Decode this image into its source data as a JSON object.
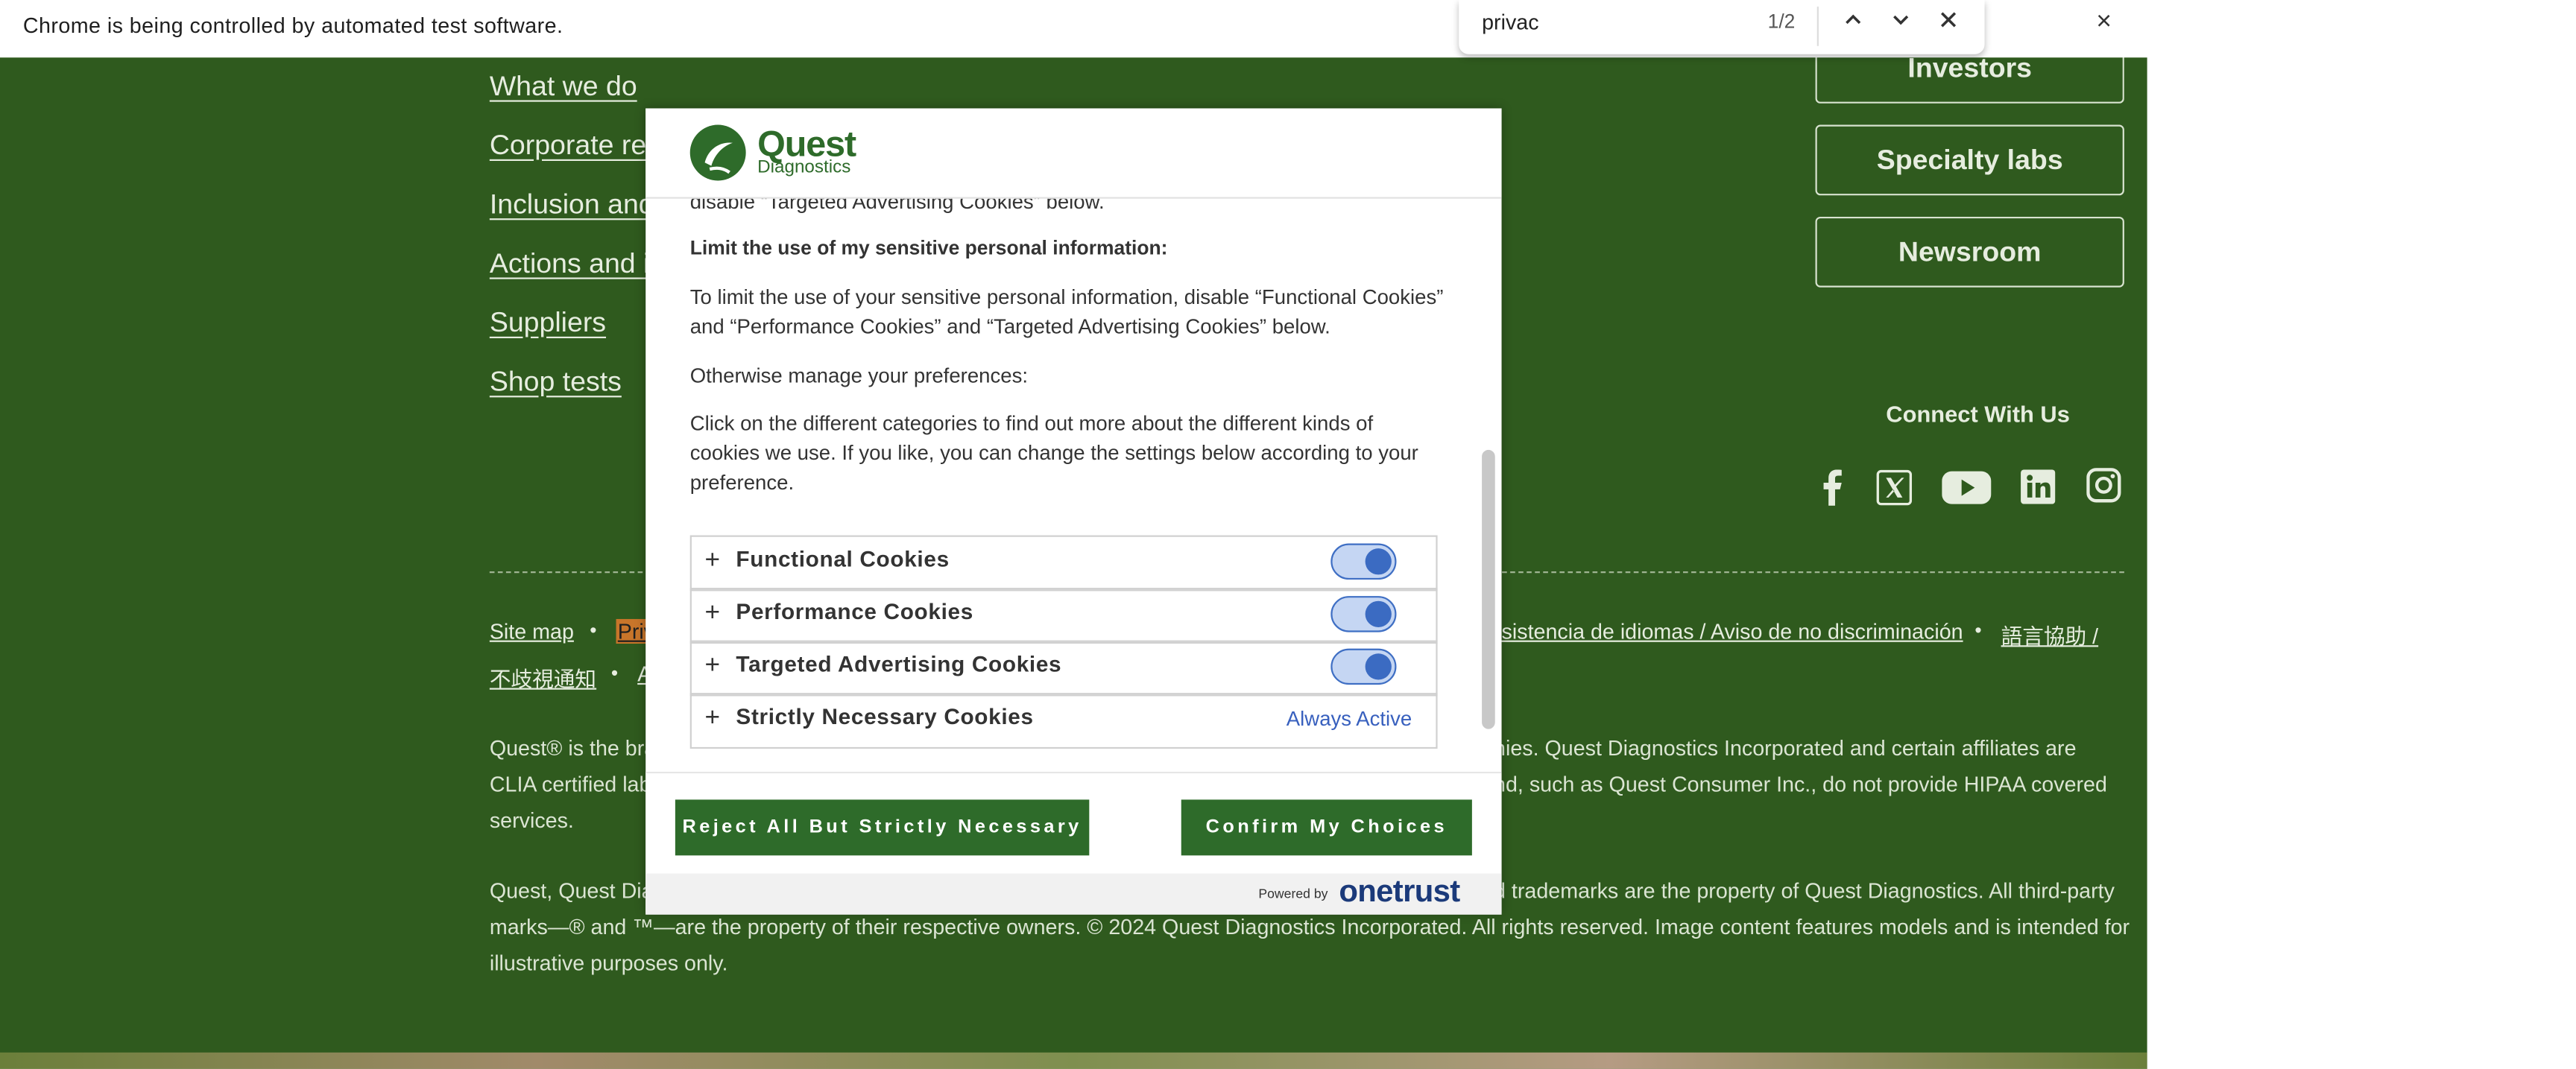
{
  "banner": {
    "text": "Chrome is being controlled by automated test software.",
    "close_icon": "×"
  },
  "find": {
    "query": "privac",
    "count": "1/2",
    "prev": "⌃",
    "next": "⌄",
    "close": "×"
  },
  "footer": {
    "links": [
      "What we do",
      "Corporate res",
      "Inclusion and",
      "Actions and in",
      "Suppliers",
      "Shop tests"
    ],
    "side_buttons": [
      "Investors",
      "Specialty labs",
      "Newsroom"
    ],
    "connect": "Connect With Us",
    "bottom_links": {
      "site_map": "Site map",
      "privacy": "Priv",
      "spanish": "sistencia de idiomas / Aviso de no discriminación",
      "chinese1": "語言協助 /",
      "chinese2": "不歧視通知",
      "a": "A"
    },
    "para1": {
      "line1_left": "Quest® is the bra",
      "line1_right": "anies. Quest Diagnostics Incorporated and certain affiliates are",
      "line2_left": "CLIA certified lab",
      "line2_right": "and, such as Quest Consumer Inc., do not provide HIPAA covered",
      "line3": "services."
    },
    "para2": {
      "line1_left": "Quest, Quest Dia",
      "line1_right": "ed trademarks are the property of Quest Diagnostics. All third-party",
      "line2": "marks—® and ™—are the property of their respective owners. © 2024 Quest Diagnostics Incorporated. All rights reserved. Image content features models and is intended for",
      "line3": "illustrative purposes only."
    }
  },
  "modal": {
    "logo": {
      "name": "Quest",
      "sub": "Diagnostics"
    },
    "cut_text": "disable “Targeted Advertising Cookies” below.",
    "limit_heading": "Limit the use of my sensitive personal information:",
    "limit_text": "To limit the use of your sensitive personal information, disable “Functional Cookies” and “Performance Cookies” and “Targeted Advertising Cookies” below.",
    "otherwise": "Otherwise manage your preferences:",
    "click_text": "Click on the different categories to find out more about the different kinds of cookies we use. If you like, you can change the settings below according to your preference.",
    "categories": [
      {
        "title": "Functional Cookies",
        "enabled": true
      },
      {
        "title": "Performance Cookies",
        "enabled": true
      },
      {
        "title": "Targeted Advertising Cookies",
        "enabled": true
      },
      {
        "title": "Strictly Necessary Cookies",
        "status": "Always Active"
      }
    ],
    "reject_label": "Reject All But Strictly Necessary",
    "confirm_label": "Confirm My Choices",
    "powered_by": "Powered by",
    "onetrust": "onetrust",
    "accent_color": "#2e6b2a"
  }
}
